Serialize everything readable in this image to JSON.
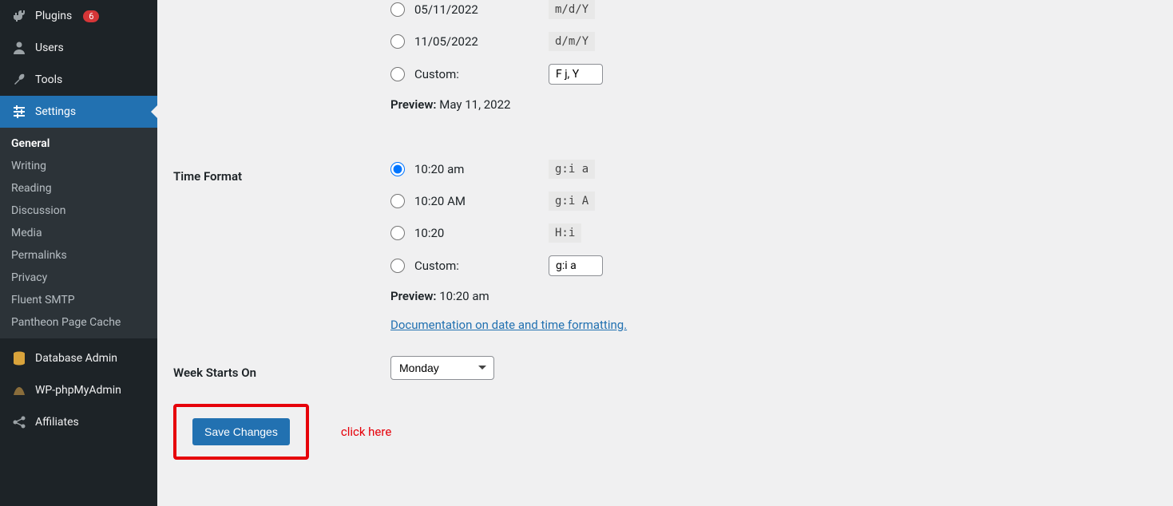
{
  "sidebar": {
    "plugins": {
      "label": "Plugins",
      "badge": "6"
    },
    "users": {
      "label": "Users"
    },
    "tools": {
      "label": "Tools"
    },
    "settings": {
      "label": "Settings"
    },
    "sub": {
      "general": "General",
      "writing": "Writing",
      "reading": "Reading",
      "discussion": "Discussion",
      "media": "Media",
      "permalinks": "Permalinks",
      "privacy": "Privacy",
      "fluent_smtp": "Fluent SMTP",
      "pantheon": "Pantheon Page Cache"
    },
    "database_admin": {
      "label": "Database Admin"
    },
    "wp_phpmyadmin": {
      "label": "WP-phpMyAdmin"
    },
    "affiliates": {
      "label": "Affiliates"
    }
  },
  "date_format": {
    "options": [
      {
        "label": "05/11/2022",
        "code": "m/d/Y"
      },
      {
        "label": "11/05/2022",
        "code": "d/m/Y"
      }
    ],
    "custom_label": "Custom:",
    "custom_value": "F j, Y",
    "preview_label": "Preview:",
    "preview_value": "May 11, 2022"
  },
  "time_format": {
    "title": "Time Format",
    "options": [
      {
        "label": "10:20 am",
        "code": "g:i a",
        "selected": true
      },
      {
        "label": "10:20 AM",
        "code": "g:i A"
      },
      {
        "label": "10:20",
        "code": "H:i"
      }
    ],
    "custom_label": "Custom:",
    "custom_value": "g:i a",
    "preview_label": "Preview:",
    "preview_value": "10:20 am",
    "doc_link": "Documentation on date and time formatting."
  },
  "week_starts": {
    "title": "Week Starts On",
    "value": "Monday"
  },
  "save_button": "Save Changes",
  "annotation": "click here"
}
